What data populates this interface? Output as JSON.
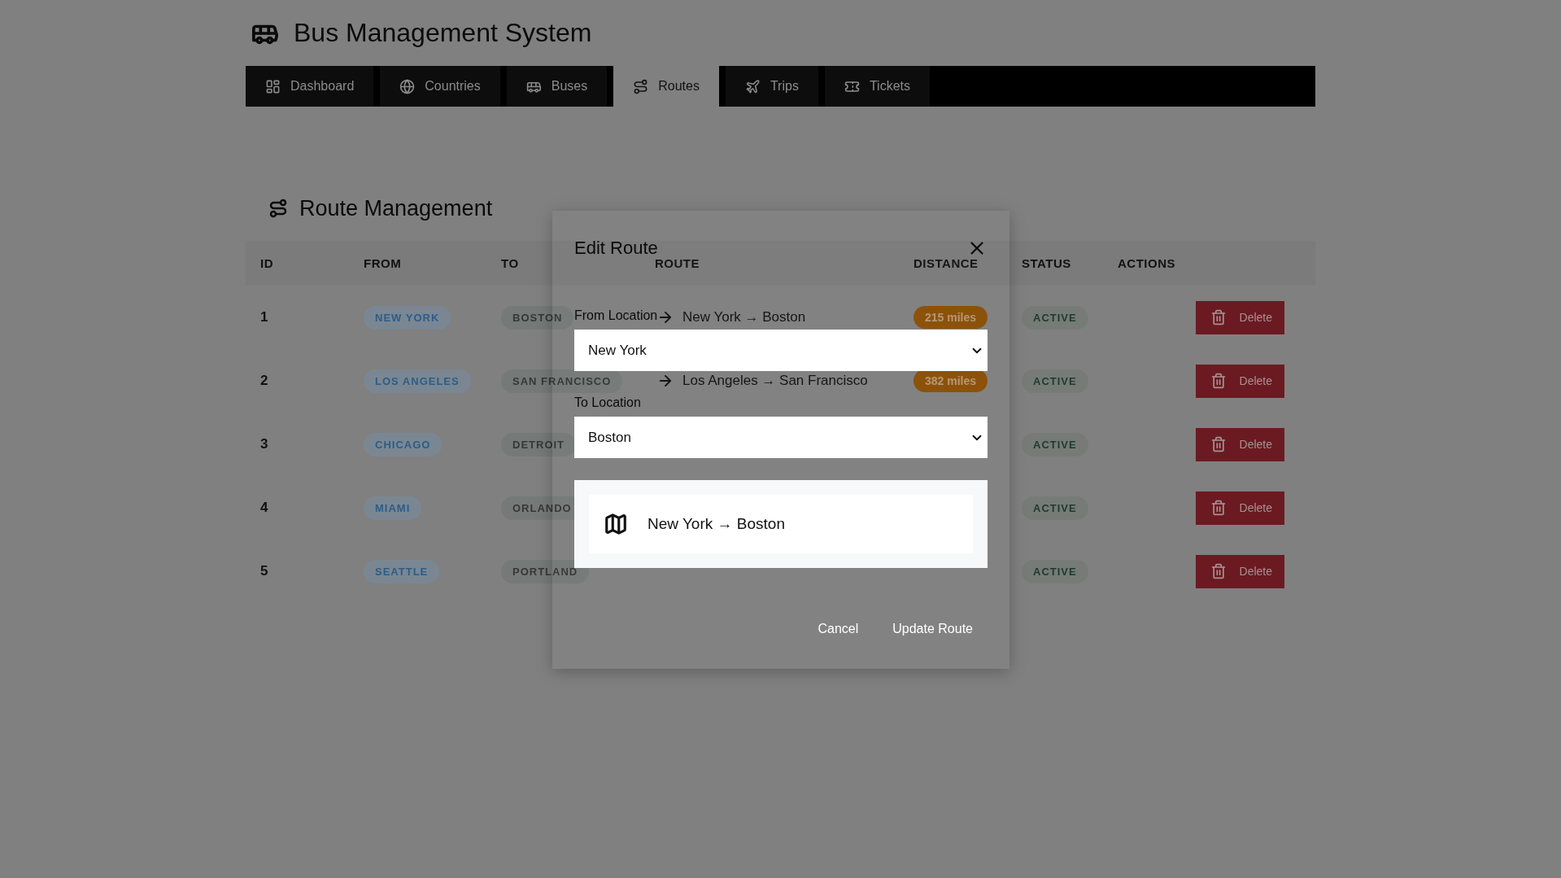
{
  "app_title": "Bus Management System",
  "nav": [
    {
      "label": "Dashboard",
      "selected": false
    },
    {
      "label": "Countries",
      "selected": false
    },
    {
      "label": "Buses",
      "selected": false
    },
    {
      "label": "Routes",
      "selected": true
    },
    {
      "label": "Trips",
      "selected": false
    },
    {
      "label": "Tickets",
      "selected": false
    }
  ],
  "section_title": "Route Management",
  "table": {
    "columns": [
      "ID",
      "FROM",
      "TO",
      "ROUTE",
      "DISTANCE",
      "STATUS",
      "ACTIONS"
    ],
    "rows": [
      {
        "id": "1",
        "from": "NEW YORK",
        "to": "BOSTON",
        "route": "New York → Boston",
        "distance": "215 miles",
        "status": "ACTIVE",
        "action": "Delete"
      },
      {
        "id": "2",
        "from": "LOS ANGELES",
        "to": "SAN FRANCISCO",
        "route": "Los Angeles → San Francisco",
        "distance": "382 miles",
        "status": "ACTIVE",
        "action": "Delete"
      },
      {
        "id": "3",
        "from": "CHICAGO",
        "to": "DETROIT",
        "status": "ACTIVE",
        "action": "Delete"
      },
      {
        "id": "4",
        "from": "MIAMI",
        "to": "ORLANDO",
        "status": "ACTIVE",
        "action": "Delete"
      },
      {
        "id": "5",
        "from": "SEATTLE",
        "to": "PORTLAND",
        "status": "ACTIVE",
        "action": "Delete"
      }
    ]
  },
  "modal": {
    "title": "Edit Route",
    "fields": [
      {
        "label": "From Location",
        "value": "New York"
      },
      {
        "label": "To Location",
        "value": "Boston"
      }
    ],
    "preview": "New York → Boston",
    "buttons": [
      "Cancel",
      "Update Route"
    ]
  }
}
